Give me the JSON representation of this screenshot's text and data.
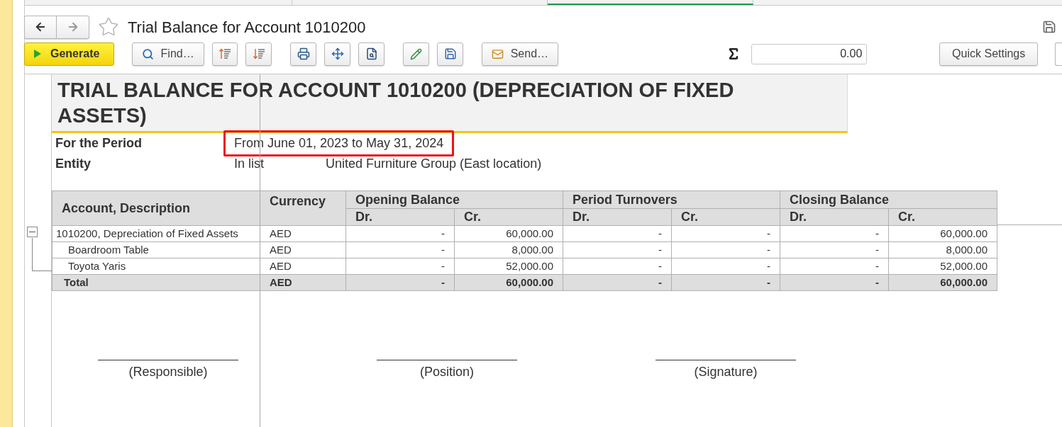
{
  "window": {
    "title": "Trial Balance for Account 1010200"
  },
  "toolbar": {
    "generate": "Generate",
    "find": "Find…",
    "send": "Send…",
    "sum": "0.00",
    "quick_settings": "Quick Settings"
  },
  "report": {
    "title": "TRIAL BALANCE FOR ACCOUNT 1010200 (DEPRECIATION OF FIXED ASSETS)",
    "parameters": [
      {
        "label": "For the Period",
        "value": "From June 01, 2023 to May 31, 2024",
        "highlighted": true
      },
      {
        "label": "Entity",
        "value": "In list",
        "value_2": "United Furniture Group (East location)",
        "highlighted": false
      }
    ],
    "table": {
      "columns": [
        {
          "label": "Account, Description"
        },
        {
          "label": "Currency"
        },
        {
          "label": "Opening Balance",
          "sub": [
            "Dr.",
            "Cr."
          ]
        },
        {
          "label": "Period Turnovers",
          "sub": [
            "Dr.",
            "Cr."
          ]
        },
        {
          "label": "Closing Balance",
          "sub": [
            "Dr.",
            "Cr."
          ]
        }
      ],
      "rows": [
        {
          "account": "1010200, Depreciation of Fixed Assets",
          "currency": "AED",
          "values": [
            "-",
            "60,000.00",
            "-",
            "-",
            "-",
            "60,000.00"
          ],
          "expanded": true,
          "children": [
            {
              "account": "Boardroom Table",
              "currency": "AED",
              "values": [
                "-",
                "8,000.00",
                "-",
                "-",
                "-",
                "8,000.00"
              ]
            },
            {
              "account": "Toyota Yaris",
              "currency": "AED",
              "values": [
                "-",
                "52,000.00",
                "-",
                "-",
                "-",
                "52,000.00"
              ]
            }
          ]
        }
      ],
      "total": {
        "label": "Total",
        "currency": "AED",
        "values": [
          "-",
          "60,000.00",
          "-",
          "-",
          "-",
          "60,000.00"
        ]
      }
    },
    "signatures": [
      "(Responsible)",
      "(Position)",
      "(Signature)"
    ]
  }
}
